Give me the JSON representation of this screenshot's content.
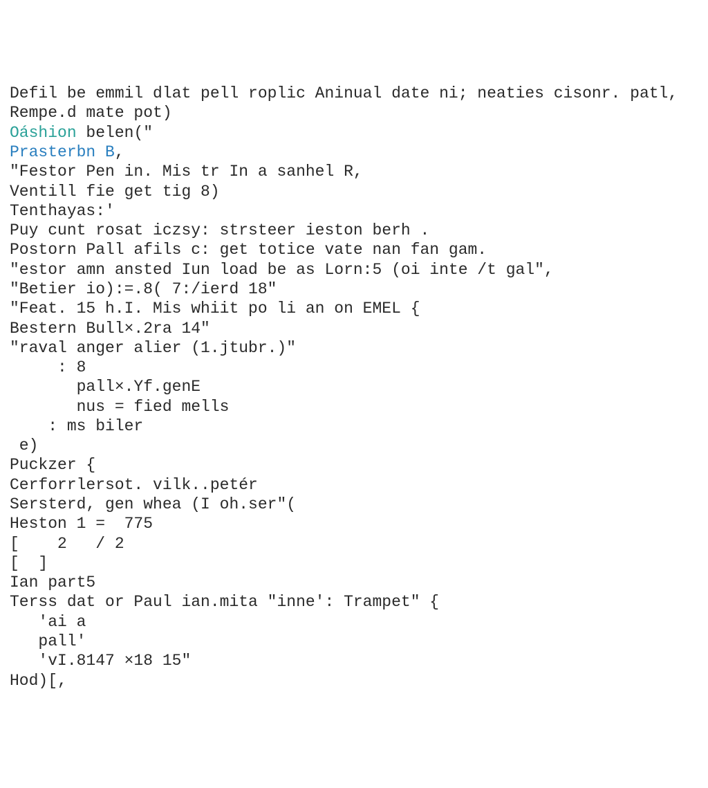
{
  "lines": {
    "l01a": "Defil be emmil dlat pell roplic Aninual date ni; neaties cisonr. patl,",
    "l01b": "Rempe.d mate pot)",
    "l02": "",
    "l03a": "Oáshion",
    "l03b": " belen(\"",
    "l04a": "Prasterbn B",
    "l04b": ",",
    "l05": "\"Festor Pen in. Mis tr In a sanhel R,",
    "l06": "Ventill fie get tig 8)",
    "l07": "Tenthayas:'",
    "l08": "",
    "l09": "Puy cunt rosat iczsy: strsteer ieston berh .",
    "l10": "",
    "l11": "Postorn Pall afils c: get totice vate nan fan gam.",
    "l12": "\"estor amn ansted Iun load be as Lorn:5 (oi inte /t gal\",",
    "l13": "\"Betier io):=.8( 7:/ierd 18\"",
    "l14": "\"Feat. 15 h.I. Mis whiit po li an on EMEL {",
    "l15": "Bestern Bull×.2ra 14\"",
    "l16": "\"raval anger alier (1.jtubr.)\"",
    "l17": "     : 8",
    "l18": "       pall×.Yf.genE",
    "l19": "       nus = fied mells",
    "l20": "    : ms biler",
    "l21": " e)",
    "l22": "",
    "l23": "Puckzer {",
    "l24": "Cerforrlersot. vilk..petér",
    "l25": "Sersterd, gen whea (I oh.ser\"(",
    "l26": "Heston 1 =  775",
    "l27": "[    2   / 2",
    "l28": "[  ]",
    "l29": "",
    "l30": "Ian part5",
    "l31": "Terss dat or Paul ian.mita \"inne': Trampet\" {",
    "l32": "   'ai a",
    "l33": "   pall'",
    "l34": "   'vI.8147 ×18 15\"",
    "l35": "Hod)[,"
  }
}
